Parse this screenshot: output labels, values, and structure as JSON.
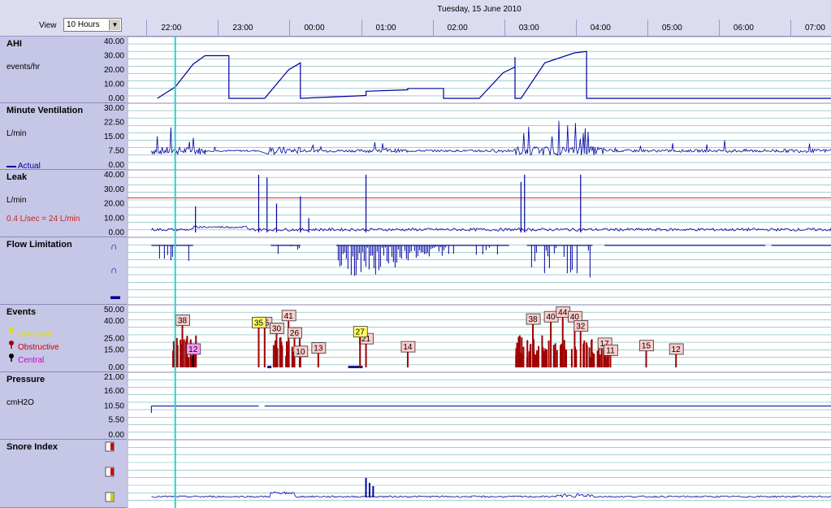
{
  "view": {
    "label": "View",
    "value": "10 Hours"
  },
  "date_title": "Tuesday, 15 June 2010",
  "time_labels": [
    "22:00",
    "23:00",
    "00:00",
    "01:00",
    "02:00",
    "03:00",
    "04:00",
    "05:00",
    "06:00",
    "07:00"
  ],
  "panels": {
    "ahi": {
      "title": "AHI",
      "unit": "events/hr",
      "ticks": [
        "40.00",
        "30.00",
        "20.00",
        "10.00",
        "0.00"
      ]
    },
    "mv": {
      "title": "Minute Ventilation",
      "unit": "L/min",
      "ticks": [
        "30.00",
        "22.50",
        "15.00",
        "7.50",
        "0.00"
      ],
      "legend": "Actual"
    },
    "leak": {
      "title": "Leak",
      "unit": "L/min",
      "threshold_text": "0.4 L/sec = 24 L/min",
      "ticks": [
        "40.00",
        "30.00",
        "20.00",
        "10.00",
        "0.00"
      ]
    },
    "flow": {
      "title": "Flow Limitation"
    },
    "events": {
      "title": "Events",
      "ticks": [
        "50.00",
        "40.00",
        "25.00",
        "15.00",
        "0.00"
      ],
      "legend": [
        "Unknown",
        "Obstructive",
        "Central"
      ]
    },
    "pressure": {
      "title": "Pressure",
      "unit": "cmH2O",
      "ticks": [
        "21.00",
        "16.00",
        "10.50",
        "5.50",
        "0.00"
      ]
    },
    "snore": {
      "title": "Snore Index"
    }
  },
  "chart_data": [
    {
      "type": "line",
      "title": "AHI",
      "ylabel": "events/hr",
      "ylim": [
        0,
        40
      ],
      "x_unit": "hours",
      "x_range": [
        "21:40",
        "07:30"
      ],
      "points": [
        [
          "22:05",
          0
        ],
        [
          "22:20",
          8
        ],
        [
          "22:35",
          24
        ],
        [
          "22:45",
          30
        ],
        [
          "23:05",
          30
        ],
        [
          "23:05",
          0
        ],
        [
          "23:35",
          0
        ],
        [
          "23:55",
          20
        ],
        [
          "24:05",
          25
        ],
        [
          "24:05",
          0
        ],
        [
          "25:00",
          2
        ],
        [
          "25:00",
          5
        ],
        [
          "25:35",
          6
        ],
        [
          "25:35",
          7
        ],
        [
          "26:05",
          7
        ],
        [
          "26:05",
          0
        ],
        [
          "26:35",
          0
        ],
        [
          "26:55",
          18
        ],
        [
          "27:05",
          22
        ],
        [
          "27:05",
          0
        ],
        [
          "27:05",
          29
        ],
        [
          "27:05",
          0
        ],
        [
          "27:10",
          0
        ],
        [
          "27:30",
          25
        ],
        [
          "27:55",
          32
        ],
        [
          "28:05",
          33
        ],
        [
          "28:05",
          0
        ],
        [
          "29:30",
          0
        ],
        [
          "31:30",
          0
        ],
        [
          "31:35",
          2
        ],
        [
          "32:30",
          2
        ]
      ],
      "cursor": "22:20"
    },
    {
      "type": "line",
      "title": "Minute Ventilation",
      "ylabel": "L/min",
      "ylim": [
        0,
        30
      ],
      "series": [
        {
          "name": "Actual",
          "baseline": 7.5,
          "range": [
            5,
            26
          ]
        }
      ]
    },
    {
      "type": "line",
      "title": "Leak",
      "ylabel": "L/min",
      "ylim": [
        0,
        40
      ],
      "threshold": 24,
      "spikes": [
        [
          "22:37",
          18
        ],
        [
          "23:30",
          40
        ],
        [
          "23:37",
          38
        ],
        [
          "23:45",
          20
        ],
        [
          "24:05",
          25
        ],
        [
          "24:12",
          10
        ],
        [
          "25:00",
          40
        ],
        [
          "27:10",
          35
        ],
        [
          "27:13",
          40
        ],
        [
          "28:00",
          40
        ]
      ]
    },
    {
      "type": "bar",
      "title": "Flow Limitation",
      "segments": [
        [
          "22:00",
          "22:35"
        ],
        [
          "23:40",
          "24:05"
        ],
        [
          "24:35",
          "27:00"
        ],
        [
          "27:15",
          "28:10"
        ],
        [
          "28:20",
          "30:35"
        ],
        [
          "30:40",
          "32:30"
        ]
      ]
    },
    {
      "type": "scatter",
      "title": "Events",
      "ylim": [
        0,
        50
      ],
      "series": [
        {
          "name": "Obstructive",
          "labels": [
            "38",
            "35",
            "30",
            "41",
            "26",
            "10",
            "13",
            "21",
            "14",
            "38",
            "40",
            "44",
            "40",
            "32",
            "17",
            "11",
            "15",
            "12"
          ],
          "x": [
            "22:26",
            "23:35",
            "23:45",
            "23:55",
            "24:00",
            "24:05",
            "24:20",
            "25:00",
            "25:35",
            "27:20",
            "27:35",
            "27:45",
            "27:55",
            "28:00",
            "28:20",
            "28:25",
            "28:55",
            "29:20"
          ],
          "y": [
            37,
            35,
            30,
            41,
            26,
            10,
            13,
            21,
            14,
            38,
            40,
            44,
            40,
            32,
            17,
            11,
            15,
            12
          ]
        },
        {
          "name": "Unknown",
          "labels": [
            "35",
            "27"
          ],
          "x": [
            "23:30",
            "24:55"
          ],
          "y": [
            35,
            27
          ]
        },
        {
          "name": "Central",
          "labels": [
            "12",
            "14"
          ],
          "x": [
            "22:35",
            "32:28"
          ],
          "y": [
            12,
            14
          ]
        }
      ]
    },
    {
      "type": "line",
      "title": "Pressure",
      "ylabel": "cmH2O",
      "ylim": [
        0,
        21
      ],
      "points": [
        [
          "22:00",
          8
        ],
        [
          "22:00",
          10.5
        ],
        [
          "23:30",
          10.5
        ],
        [
          "23:35",
          10.5
        ],
        [
          "32:30",
          10.5
        ]
      ]
    },
    {
      "type": "line",
      "title": "Snore Index",
      "peaks": [
        [
          "23:45",
          0.3
        ],
        [
          "24:00",
          0.2
        ],
        [
          "25:00",
          0.9
        ],
        [
          "27:50",
          0.2
        ]
      ]
    }
  ],
  "colors": {
    "line": "#0000a0",
    "grid": "#3c9c9c",
    "cursor": "#33cccc",
    "threshold": "#cc3333",
    "obstructive": "#a00000",
    "unknown": "#ffff66",
    "central_label": "#ff99ff",
    "obstructive_label": "#ffcccc"
  }
}
